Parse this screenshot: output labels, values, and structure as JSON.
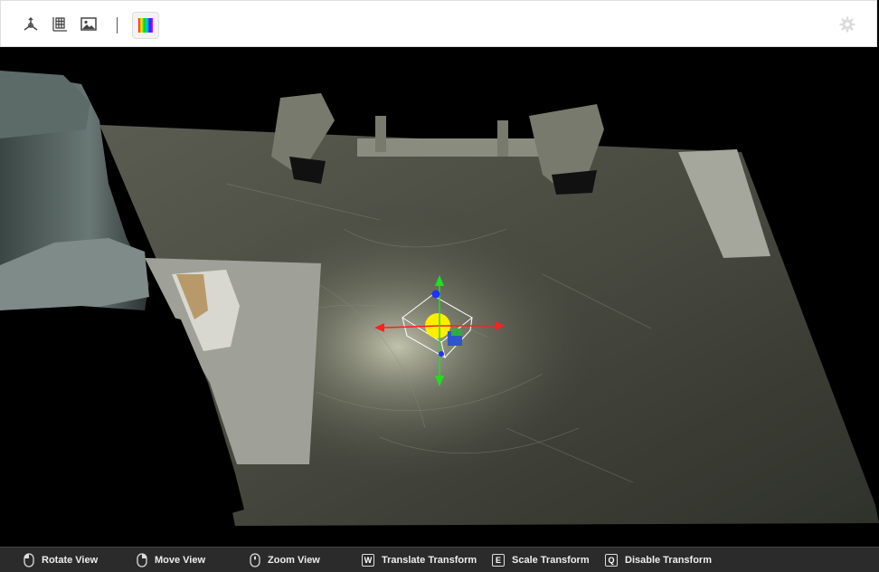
{
  "toolbar": {
    "icons": [
      "axes-3d-icon",
      "grid-icon",
      "image-icon",
      "color-spectrum-icon",
      "settings-gear-icon"
    ]
  },
  "status_bar": {
    "hints": [
      {
        "key_icon": "mouse-left-icon",
        "label": "Rotate View"
      },
      {
        "key_icon": "mouse-right-icon",
        "label": "Move View"
      },
      {
        "key_icon": "mouse-wheel-icon",
        "label": "Zoom View"
      },
      {
        "key": "W",
        "label": "Translate Transform"
      },
      {
        "key": "E",
        "label": "Scale Transform"
      },
      {
        "key": "Q",
        "label": "Disable Transform"
      }
    ]
  },
  "colors": {
    "gizmo_x": "#ff2020",
    "gizmo_y": "#22dd22",
    "gizmo_z": "#2030ff",
    "gizmo_center": "#ffee00"
  }
}
